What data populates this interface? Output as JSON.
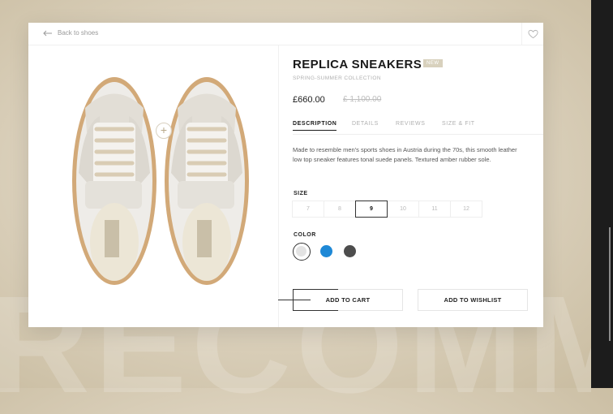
{
  "background": {
    "watermark": "RECOMMENDED"
  },
  "nav": {
    "back_label": "Back to shoes"
  },
  "product": {
    "title": "REPLICA SNEAKERS",
    "badge": "NEW",
    "collection": "SPRING-SUMMER COLLECTION",
    "price": "£660.00",
    "old_price": "£ 1,100.00",
    "description": "Made to resemble men's sports shoes in Austria during the 70s, this smooth leather low top sneaker features tonal suede panels. Textured amber rubber sole."
  },
  "tabs": [
    {
      "label": "DESCRIPTION",
      "active": true
    },
    {
      "label": "DETAILS",
      "active": false
    },
    {
      "label": "REVIEWS",
      "active": false
    },
    {
      "label": "SIZE & FIT",
      "active": false
    }
  ],
  "size": {
    "label": "SIZE",
    "options": [
      "7",
      "8",
      "9",
      "10",
      "11",
      "12"
    ],
    "selected": "9"
  },
  "color": {
    "label": "COLOR",
    "options": [
      {
        "name": "white",
        "hex": "#e3e3e3",
        "selected": true
      },
      {
        "name": "blue",
        "hex": "#1e88d6",
        "selected": false
      },
      {
        "name": "dark-grey",
        "hex": "#4d4d4d",
        "selected": false
      }
    ]
  },
  "actions": {
    "add_to_cart": "ADD TO CART",
    "add_to_wishlist": "ADD TO WISHLIST"
  },
  "icons": [
    "arrow-left-icon",
    "heart-icon",
    "plus-icon"
  ]
}
